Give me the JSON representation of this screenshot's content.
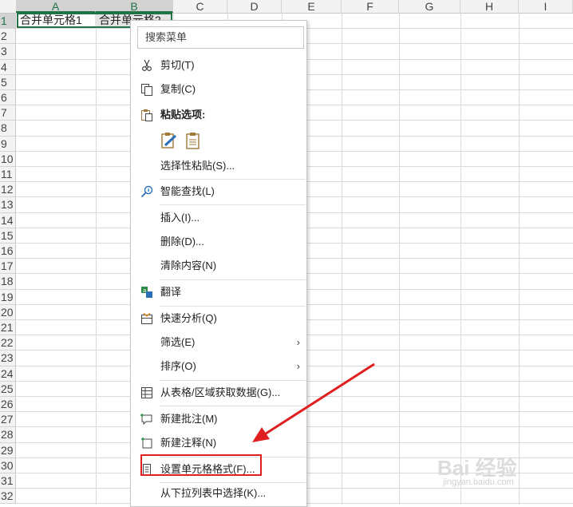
{
  "columns": [
    "A",
    "B",
    "C",
    "D",
    "E",
    "F",
    "G",
    "H",
    "I"
  ],
  "rows": [
    "1",
    "2",
    "3",
    "4",
    "5",
    "6",
    "7",
    "8",
    "9",
    "10",
    "11",
    "12",
    "13",
    "14",
    "15",
    "16",
    "17",
    "18",
    "19",
    "20",
    "21",
    "22",
    "23",
    "24",
    "25",
    "26",
    "27",
    "28",
    "29",
    "30",
    "31",
    "32"
  ],
  "cells": {
    "a1": "合并单元格1",
    "b1": "合并单元格2"
  },
  "colors": {
    "accent": "#217346",
    "highlight": "#e02020"
  },
  "menu": {
    "search_placeholder": "搜索菜单",
    "items": [
      {
        "label": "剪切(T)",
        "icon": "scissors-icon"
      },
      {
        "label": "复制(C)",
        "icon": "copy-icon"
      },
      {
        "label": "粘贴选项:",
        "icon": "paste-icon"
      },
      {
        "label": "选择性粘贴(S)...",
        "icon": ""
      },
      {
        "label": "智能查找(L)",
        "icon": "smart-lookup-icon"
      },
      {
        "label": "插入(I)...",
        "icon": ""
      },
      {
        "label": "删除(D)...",
        "icon": ""
      },
      {
        "label": "清除内容(N)",
        "icon": ""
      },
      {
        "label": "翻译",
        "icon": "translate-icon"
      },
      {
        "label": "快速分析(Q)",
        "icon": "quick-analysis-icon"
      },
      {
        "label": "筛选(E)",
        "icon": "",
        "submenu": "›"
      },
      {
        "label": "排序(O)",
        "icon": "",
        "submenu": "›"
      },
      {
        "label": "从表格/区域获取数据(G)...",
        "icon": "table-icon"
      },
      {
        "label": "新建批注(M)",
        "icon": "new-comment-icon"
      },
      {
        "label": "新建注释(N)",
        "icon": "new-note-icon"
      },
      {
        "label": "设置单元格格式(F)...",
        "icon": "format-cells-icon"
      },
      {
        "label": "从下拉列表中选择(K)...",
        "icon": ""
      }
    ]
  },
  "watermark": {
    "brand": "Bai 经验",
    "url": "jingyan.baidu.com"
  }
}
